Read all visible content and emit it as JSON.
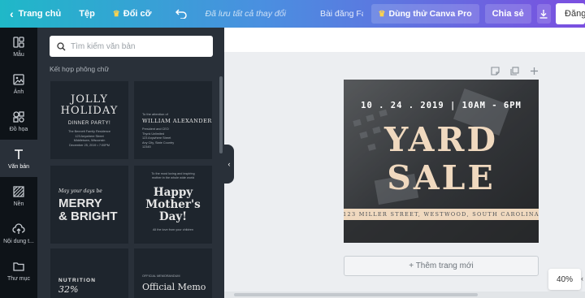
{
  "topbar": {
    "home": "Trang chủ",
    "file": "Tệp",
    "resize": "Đổi cỡ",
    "saved_status": "Đã lưu tất cả thay đổi",
    "doc_title": "Bài đăng Facebook",
    "try_pro": "Dùng thử Canva Pro",
    "share": "Chia sẻ",
    "publish": "Đăng"
  },
  "rail": [
    {
      "label": "Mẫu",
      "icon": "layout-icon"
    },
    {
      "label": "Ảnh",
      "icon": "image-icon"
    },
    {
      "label": "Đồ họa",
      "icon": "shapes-icon"
    },
    {
      "label": "Văn bản",
      "icon": "text-icon"
    },
    {
      "label": "Nền",
      "icon": "background-icon"
    },
    {
      "label": "Nội dung t...",
      "icon": "upload-icon"
    },
    {
      "label": "Thư mục",
      "icon": "folder-icon"
    }
  ],
  "panel": {
    "search_placeholder": "Tìm kiếm văn bản",
    "section": "Kết hợp phông chữ",
    "tiles": {
      "t1": {
        "title1": "JOLLY",
        "title2": "HOLIDAY",
        "sub": "DINNER PARTY!",
        "l1": "The Bennett Family Residence",
        "l2": "123 Anywhere Street",
        "l3": "Middletown, Wisconsin",
        "l4": "December 25, 2019 • 7:00PM"
      },
      "t2": {
        "small": "To the attention of",
        "name": "WILLIAM ALEXANDER",
        "l1": "President and CEO",
        "l2": "Thynk Unlimited",
        "l3": "123 Anywhere Street",
        "l4": "Any City, State Country",
        "l5": "12345"
      },
      "t3": {
        "script": "May your days be",
        "l1": "MERRY",
        "l2": "& BRIGHT"
      },
      "t4": {
        "l1": "To the most loving and inspiring",
        "l2": "mother in the whole wide world",
        "b1": "Happy",
        "b2": "Mother's",
        "b3": "Day!",
        "foot": "All the love from your children"
      },
      "t5": {
        "label": "NUTRITION",
        "pct": "32%"
      },
      "t6": {
        "tiny": "OFFICIAL MEMORANDUM",
        "big": "Official Memo"
      }
    }
  },
  "design": {
    "date": "10 . 24 . 2019 | 10AM - 6PM",
    "line1": "YARD",
    "line2": "SALE",
    "address": "123 MILLER STREET, WESTWOOD, SOUTH CAROLINA"
  },
  "add_page": "+ Thêm trang mới",
  "zoom": "40%",
  "colors": {
    "accent_gold": "#f0d9bf",
    "rail_bg": "#0e1318",
    "panel_bg": "#293039"
  }
}
